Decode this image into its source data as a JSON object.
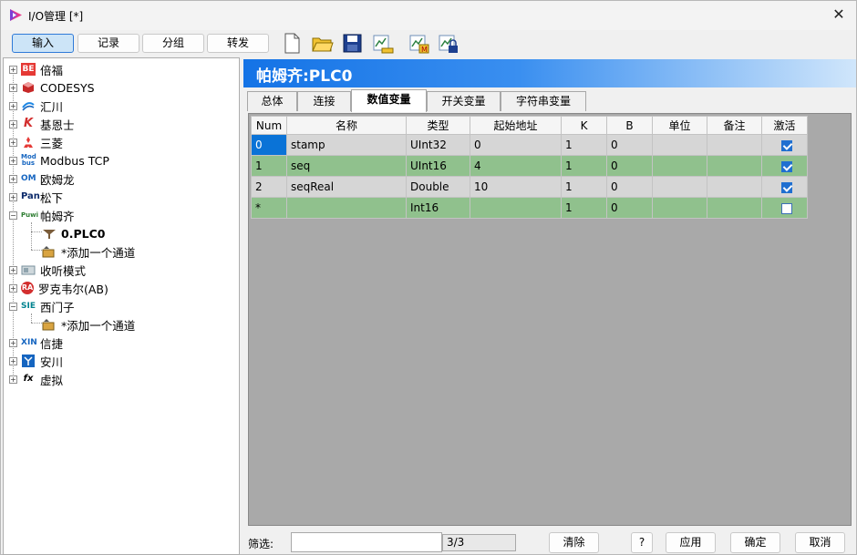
{
  "window": {
    "title": "I/O管理 [*]"
  },
  "toolbar": {
    "tabs": [
      "输入",
      "记录",
      "分组",
      "转发"
    ],
    "active_tab": "输入",
    "icons": [
      "new-file-icon",
      "open-folder-icon",
      "save-icon",
      "export-icon",
      "import-m-icon",
      "import-lock-icon"
    ]
  },
  "tree": {
    "items": [
      {
        "label": "倍福",
        "icon_text": "BE"
      },
      {
        "label": "CODESYS",
        "icon_text": ""
      },
      {
        "label": "汇川",
        "icon_text": ""
      },
      {
        "label": "基恩士",
        "icon_text": "K"
      },
      {
        "label": "三菱",
        "icon_text": ""
      },
      {
        "label": "Modbus TCP",
        "icon_text": "Mod bus"
      },
      {
        "label": "欧姆龙",
        "icon_text": "OM"
      },
      {
        "label": "松下",
        "icon_text": "Pan"
      },
      {
        "label": "帕姆齐",
        "icon_text": "Puwi"
      },
      {
        "label": "0.PLC0",
        "icon_text": ""
      },
      {
        "label": "*添加一个通道",
        "icon_text": ""
      },
      {
        "label": "收听模式",
        "icon_text": ""
      },
      {
        "label": "罗克韦尔(AB)",
        "icon_text": "RA"
      },
      {
        "label": "西门子",
        "icon_text": "SIE"
      },
      {
        "label": "*添加一个通道",
        "icon_text": ""
      },
      {
        "label": "信捷",
        "icon_text": "XIN"
      },
      {
        "label": "安川",
        "icon_text": ""
      },
      {
        "label": "虚拟",
        "icon_text": "fx"
      }
    ]
  },
  "panel": {
    "header_title": "帕姆齐:PLC0",
    "tabs": [
      "总体",
      "连接",
      "数值变量",
      "开关变量",
      "字符串变量"
    ],
    "active_tab": "数值变量"
  },
  "grid": {
    "columns": [
      "Num",
      "名称",
      "类型",
      "起始地址",
      "K",
      "B",
      "单位",
      "备注",
      "激活"
    ],
    "rows": [
      {
        "num": "0",
        "name": "stamp",
        "type": "UInt32",
        "addr": "0",
        "k": "1",
        "b": "0",
        "unit": "",
        "note": "",
        "active": true
      },
      {
        "num": "1",
        "name": "seq",
        "type": "UInt16",
        "addr": "4",
        "k": "1",
        "b": "0",
        "unit": "",
        "note": "",
        "active": true
      },
      {
        "num": "2",
        "name": "seqReal",
        "type": "Double",
        "addr": "10",
        "k": "1",
        "b": "0",
        "unit": "",
        "note": "",
        "active": true
      },
      {
        "num": "*",
        "name": "",
        "type": "Int16",
        "addr": "",
        "k": "1",
        "b": "0",
        "unit": "",
        "note": "",
        "active": false
      }
    ]
  },
  "footer": {
    "filter_label": "筛选:",
    "filter_value": "",
    "count": "3/3",
    "clear": "清除",
    "help": "?",
    "apply": "应用",
    "ok": "确定",
    "cancel": "取消"
  },
  "colors": {
    "accent": "#1473e6",
    "row_green": "#90c18d",
    "row_gray": "#d6d6d6",
    "selection": "#0a73d7"
  }
}
